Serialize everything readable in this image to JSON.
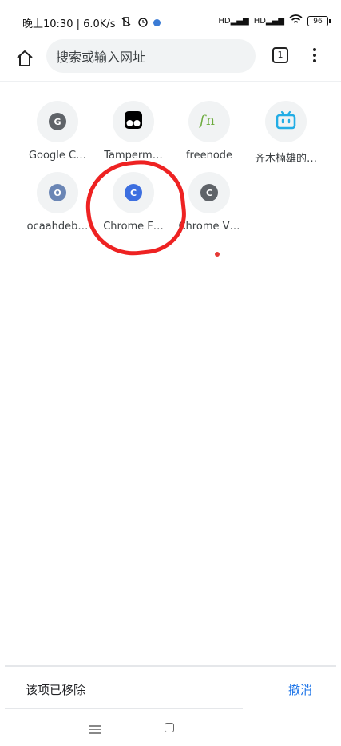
{
  "status_bar": {
    "time_speed": "晚上10:30 | 6.0K/s",
    "signal1": "HD",
    "signal2": "HD",
    "battery": "96",
    "icons": [
      "no-vibrate-icon",
      "alarm-icon",
      "browser-dot-icon",
      "signal-icon",
      "signal-icon",
      "wifi-icon",
      "battery-icon"
    ]
  },
  "toolbar": {
    "omnibox_placeholder": "搜索或输入网址",
    "tab_count": "1"
  },
  "tiles": [
    {
      "label": "Google C…",
      "letter": "G",
      "color": "#5f6368"
    },
    {
      "label": "Tamperm…",
      "icon": "tampermonkey-icon"
    },
    {
      "label": "freenode",
      "icon": "freenode-icon"
    },
    {
      "label": "齐木楠雄的…",
      "icon": "bilibili-icon",
      "color": "#23ade5"
    },
    {
      "label": "ocaahdeb…",
      "letter": "O",
      "color": "#6b86b5"
    },
    {
      "label": "Chrome F…",
      "letter": "C",
      "color": "#3d6fe0"
    },
    {
      "label": "Chrome V…",
      "letter": "C",
      "color": "#5f6368"
    }
  ],
  "snackbar": {
    "message": "该项已移除",
    "undo": "撤消"
  },
  "colors": {
    "accent": "#1a73e8",
    "annotation": "#ee2222"
  }
}
